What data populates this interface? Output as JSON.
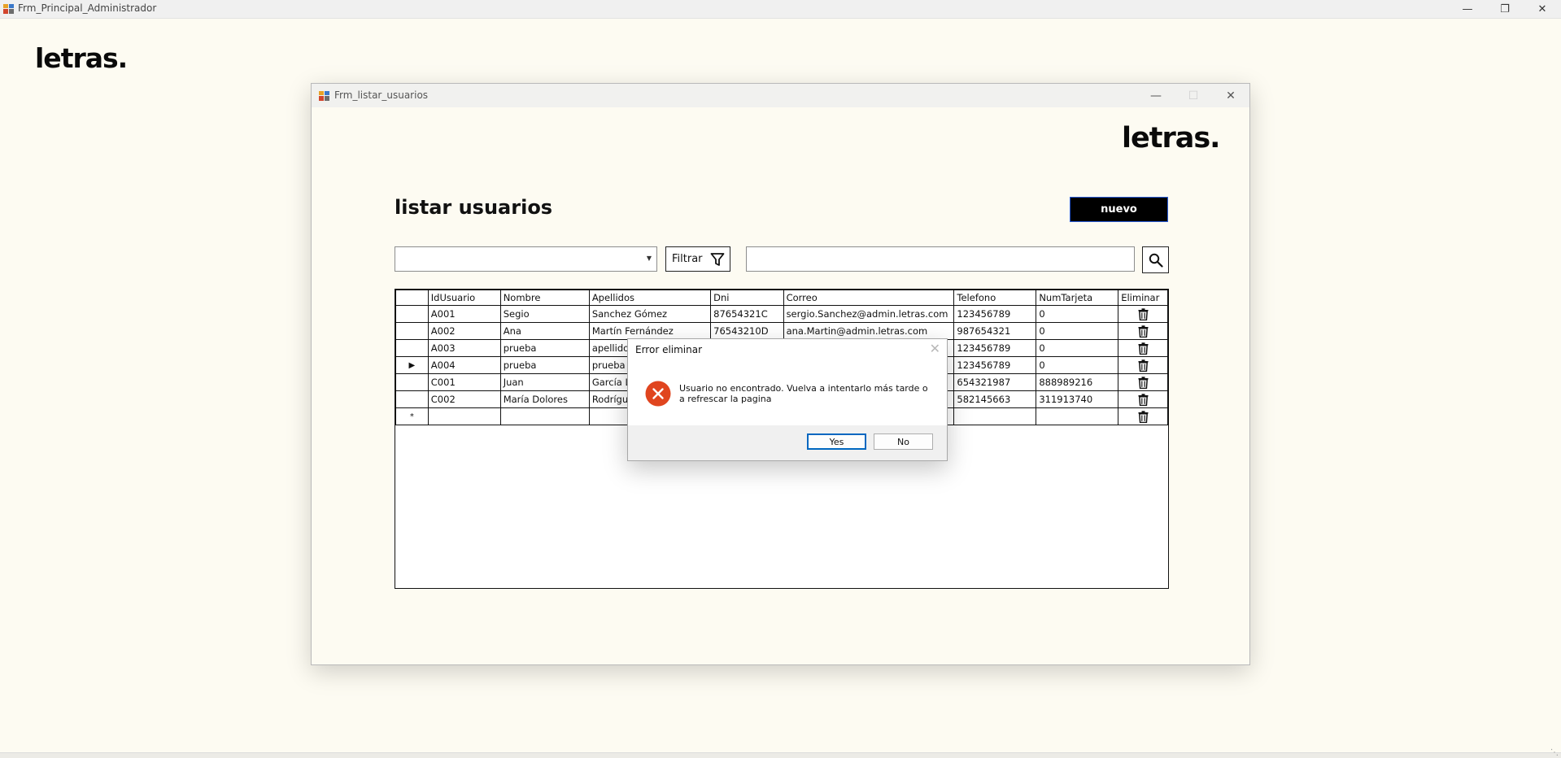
{
  "main_window": {
    "title": "Frm_Principal_Administrador",
    "logo": "letras."
  },
  "child_window": {
    "title": "Frm_listar_usuarios",
    "logo": "letras.",
    "page_title": "listar usuarios",
    "new_button": "nuevo",
    "filter_combo_value": "",
    "filter_button": "Filtrar",
    "search_value": ""
  },
  "grid": {
    "columns": [
      "IdUsuario",
      "Nombre",
      "Apellidos",
      "Dni",
      "Correo",
      "Telefono",
      "NumTarjeta",
      "Eliminar"
    ],
    "rows": [
      {
        "marker": "",
        "cells": [
          "A001",
          "Segio",
          "Sanchez Gómez",
          "87654321C",
          "sergio.Sanchez@admin.letras.com",
          "123456789",
          "0"
        ]
      },
      {
        "marker": "",
        "cells": [
          "A002",
          "Ana",
          "Martín Fernández",
          "76543210D",
          "ana.Martin@admin.letras.com",
          "987654321",
          "0"
        ]
      },
      {
        "marker": "",
        "cells": [
          "A003",
          "prueba",
          "apellido",
          "",
          "…",
          "123456789",
          "0"
        ]
      },
      {
        "marker": "▶",
        "cells": [
          "A004",
          "prueba",
          "prueba",
          "",
          "…",
          "123456789",
          "0"
        ]
      },
      {
        "marker": "",
        "cells": [
          "C001",
          "Juan",
          "García L",
          "",
          "",
          "654321987",
          "888989216"
        ]
      },
      {
        "marker": "",
        "cells": [
          "C002",
          "María Dolores",
          "Rodrígu",
          "",
          "",
          "582145663",
          "311913740"
        ]
      },
      {
        "marker": "*",
        "cells": [
          "",
          "",
          "",
          "",
          "",
          "",
          ""
        ]
      }
    ]
  },
  "dialog": {
    "title": "Error eliminar",
    "icon": "error-icon",
    "message": "Usuario no encontrado. Vuelva a intentarlo más tarde o a refrescar la pagina",
    "yes_button": "Yes",
    "no_button": "No"
  },
  "colors": {
    "background": "#fdfbf2",
    "accent_button": "#000000",
    "focus_border": "#0067c0",
    "error": "#e0451f"
  }
}
